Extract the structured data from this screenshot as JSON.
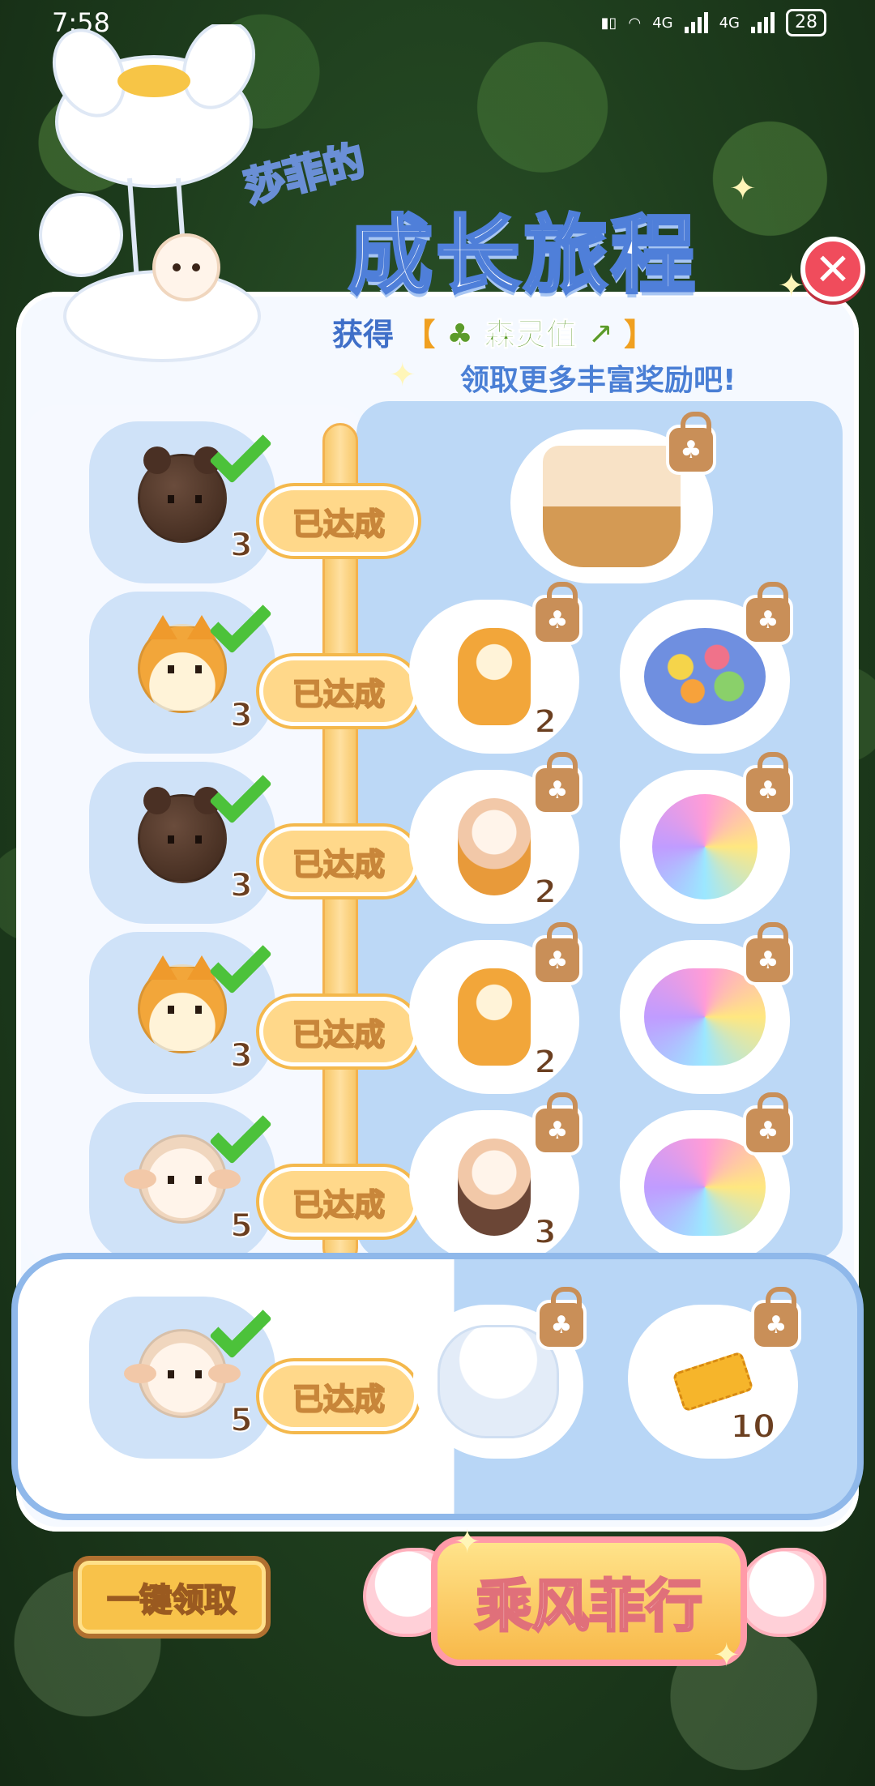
{
  "status_bar": {
    "time": "7:58",
    "network_1": "4G",
    "network_2": "4G",
    "battery": "28"
  },
  "header": {
    "title_small": "莎菲的",
    "title_big": "成长旅程",
    "subtitle_gain": "获得",
    "subtitle_bracket_open": "【",
    "subtitle_currency": "森灵值",
    "subtitle_bracket_close": "】",
    "subtitle_line2": "领取更多丰富奖励吧!"
  },
  "close_icon": "close-icon",
  "levels": [
    {
      "avatar": "bear-icon",
      "count": "3",
      "status": "已达成",
      "rewards": [
        {
          "icon": "sheep-basket-icon",
          "qty": ""
        }
      ]
    },
    {
      "avatar": "shiba-icon",
      "count": "3",
      "status": "已达成",
      "rewards": [
        {
          "icon": "shiba-figure-icon",
          "qty": "2"
        },
        {
          "icon": "flower-bouquet-icon",
          "qty": ""
        }
      ]
    },
    {
      "avatar": "bear-icon",
      "count": "3",
      "status": "已达成",
      "rewards": [
        {
          "icon": "sheep-figure-icon",
          "qty": "2"
        },
        {
          "icon": "rainbow-planet-icon",
          "qty": ""
        }
      ]
    },
    {
      "avatar": "shiba-icon",
      "count": "3",
      "status": "已达成",
      "rewards": [
        {
          "icon": "shiba-figure-icon",
          "qty": "2"
        },
        {
          "icon": "rainbow-swirl-icon",
          "qty": ""
        }
      ]
    },
    {
      "avatar": "sheep-icon",
      "count": "5",
      "status": "已达成",
      "rewards": [
        {
          "icon": "sheep-figure-icon",
          "qty": "3"
        },
        {
          "icon": "rainbow-swirl-icon",
          "qty": ""
        }
      ]
    },
    {
      "avatar": "sheep-icon",
      "count": "5",
      "status": "已达成",
      "rewards": [
        {
          "icon": "cloud-airship-icon",
          "qty": ""
        },
        {
          "icon": "ticket-icon",
          "qty": "10"
        }
      ]
    }
  ],
  "buttons": {
    "collect_all": "一键领取",
    "fly": "乘风菲行"
  },
  "colors": {
    "accent_blue": "#4f7fd9",
    "check_green": "#4cc23a",
    "pill_gold": "#ffd88a",
    "close_red": "#f04c5c"
  }
}
